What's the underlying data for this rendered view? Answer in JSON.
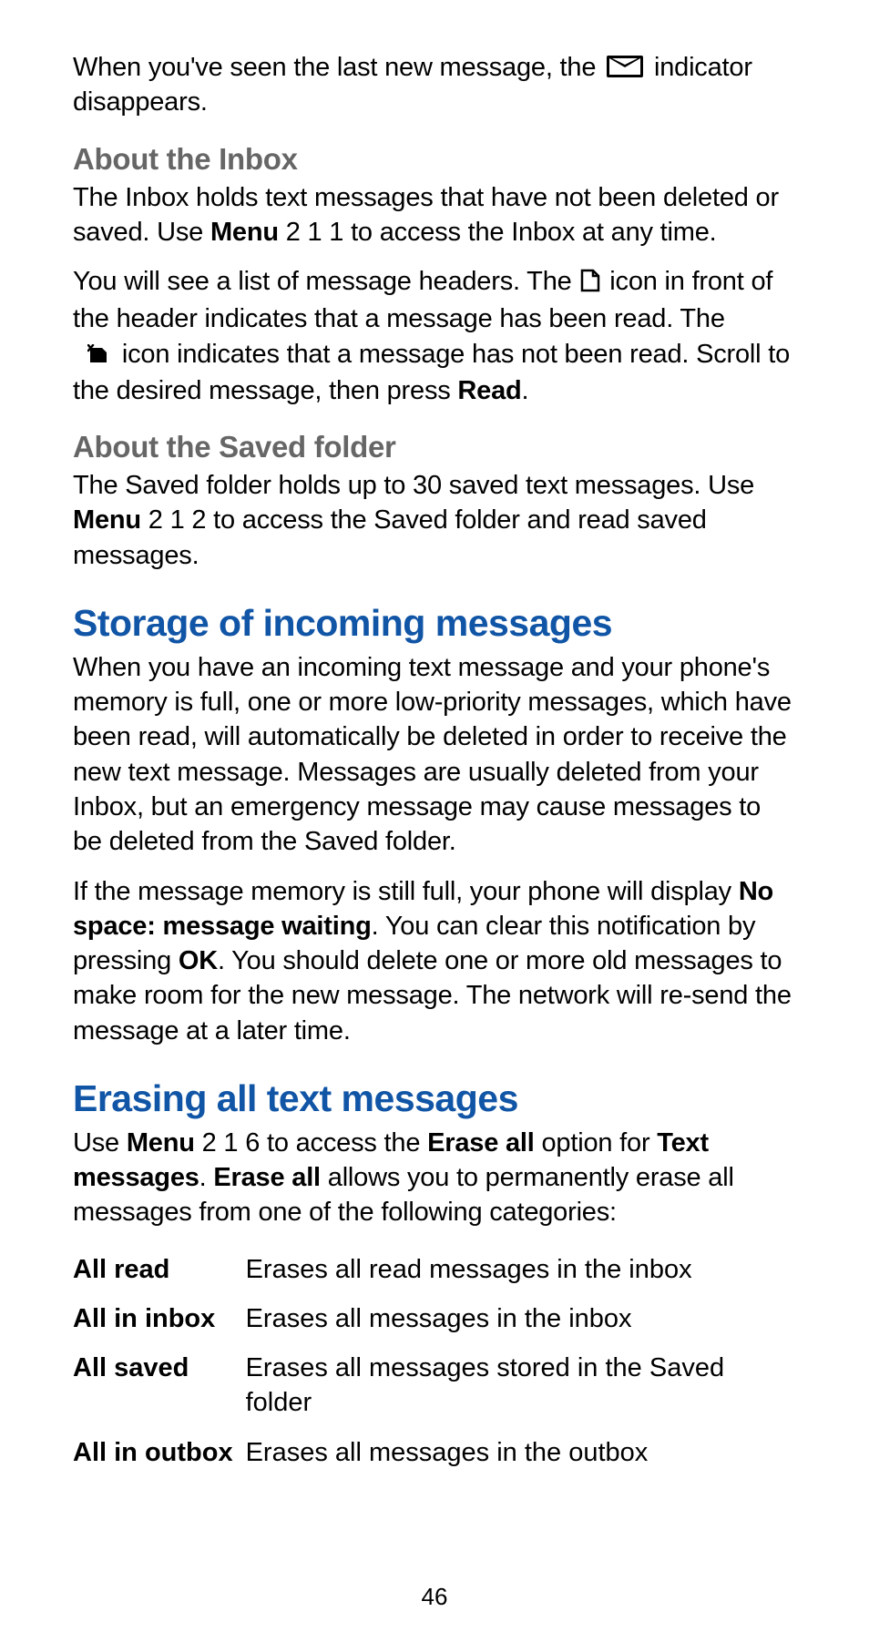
{
  "intro": {
    "line1_a": "When you've seen the last new message, the ",
    "line1_b": " indicator disappears."
  },
  "about_inbox": {
    "heading": "About the Inbox",
    "p1_a": "The Inbox holds text messages that have not been deleted or saved. Use ",
    "p1_menu": "Menu",
    "p1_b": " 2 1 1 to access the Inbox at any time.",
    "p2_a": "You will see a list of message headers. The ",
    "p2_b": " icon in front of the header indicates that a message has been read. The ",
    "p2_c": " icon indicates that a message has not been read. Scroll to the desired message, then press ",
    "p2_read": "Read",
    "p2_d": "."
  },
  "about_saved": {
    "heading": "About the Saved folder",
    "p_a": "The Saved folder holds up to 30 saved text messages. Use ",
    "p_menu": "Menu",
    "p_b": " 2 1 2 to access the Saved folder and read saved messages."
  },
  "storage": {
    "heading": "Storage of incoming messages",
    "p1": "When you have an incoming text message and your phone's memory is full, one or more low-priority messages, which have been read, will automatically be deleted in order to receive the new text message. Messages are usually deleted from your Inbox, but an emergency message may cause messages to be deleted from the Saved folder.",
    "p2_a": "If the message memory is still full, your phone will display ",
    "p2_no_space": "No space: message waiting",
    "p2_b": ". You can clear this notification by pressing ",
    "p2_ok": "OK",
    "p2_c": ". You should delete one or more old messages to make room for the new message. The network will re-send the message at a later time."
  },
  "erasing": {
    "heading": "Erasing all text messages",
    "p_a": "Use ",
    "p_menu": "Menu",
    "p_b": " 2 1 6 to access the ",
    "p_erase_all1": "Erase all",
    "p_c": " option for ",
    "p_text_msgs": "Text messages",
    "p_d": ". ",
    "p_erase_all2": "Erase all",
    "p_e": " allows you to permanently erase all messages from one of the following categories:",
    "rows": [
      {
        "label": "All read",
        "desc": "Erases all read messages in the inbox"
      },
      {
        "label": "All in inbox",
        "desc": "Erases all messages in the inbox"
      },
      {
        "label": "All saved",
        "desc": "Erases all messages stored in the Saved folder"
      },
      {
        "label": "All in outbox",
        "desc": "Erases all messages in the outbox"
      }
    ]
  },
  "page_number": "46"
}
